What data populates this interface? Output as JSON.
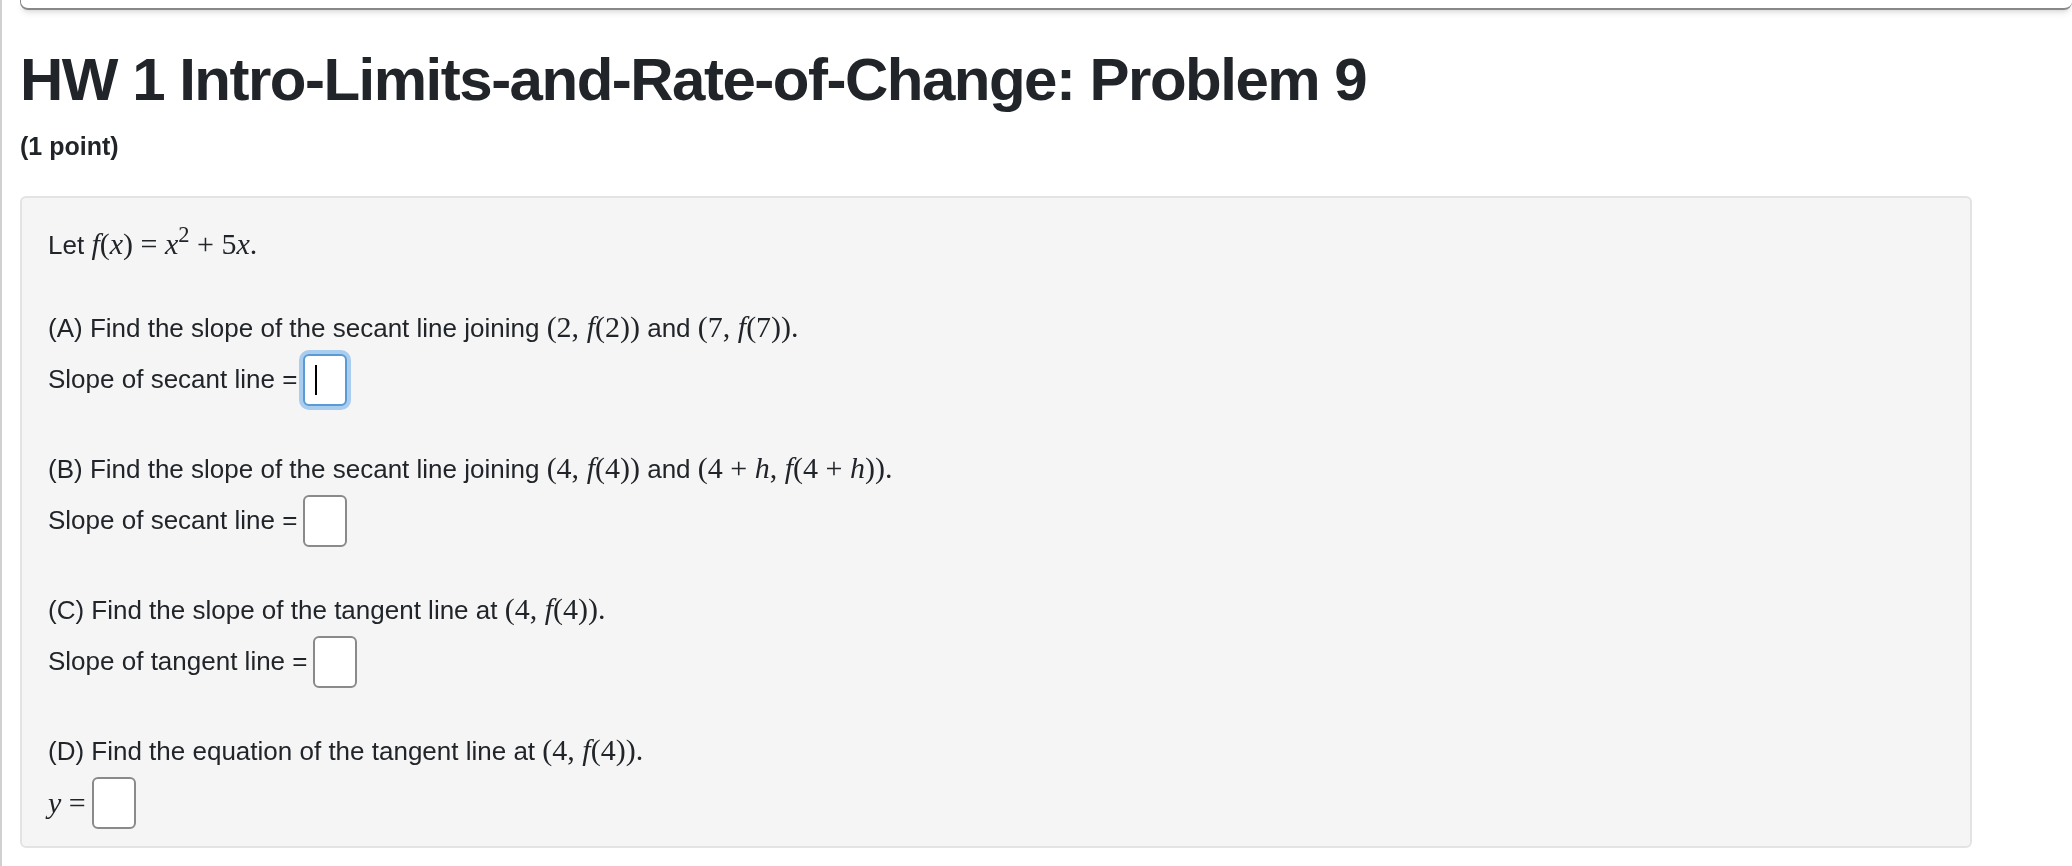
{
  "title": "HW 1 Intro-Limits-and-Rate-of-Change: Problem 9",
  "points": "(1 point)",
  "intro": [
    {
      "kind": "text",
      "text": "Let "
    },
    {
      "kind": "math",
      "text": "*f*(*x*) = *x*$^{2}$ + 5"
    },
    {
      "kind": "math",
      "text": "*x*."
    }
  ],
  "parts": [
    {
      "question": [
        {
          "kind": "text",
          "text": "(A) Find the slope of the secant line joining "
        },
        {
          "kind": "math",
          "text": "(2, *f*(2))"
        },
        {
          "kind": "text",
          "text": " and "
        },
        {
          "kind": "math",
          "text": "(7, *f*(7))."
        }
      ],
      "answer_label": {
        "kind": "text",
        "text": "Slope of secant line ="
      },
      "focused": true
    },
    {
      "question": [
        {
          "kind": "text",
          "text": "(B) Find the slope of the secant line joining "
        },
        {
          "kind": "math",
          "text": "(4, *f*(4))"
        },
        {
          "kind": "text",
          "text": " and "
        },
        {
          "kind": "math",
          "text": "(4 + *h*, *f*(4 + *h*))."
        }
      ],
      "answer_label": {
        "kind": "text",
        "text": "Slope of secant line ="
      },
      "focused": false
    },
    {
      "question": [
        {
          "kind": "text",
          "text": "(C) Find the slope of the tangent line at "
        },
        {
          "kind": "math",
          "text": "(4, *f*(4))."
        }
      ],
      "answer_label": {
        "kind": "text",
        "text": "Slope of tangent line ="
      },
      "focused": false
    },
    {
      "question": [
        {
          "kind": "text",
          "text": "(D) Find the equation of the tangent line at "
        },
        {
          "kind": "math",
          "text": "(4, *f*(4))."
        }
      ],
      "answer_label": {
        "kind": "math",
        "text": "*y* ="
      },
      "focused": false
    }
  ]
}
